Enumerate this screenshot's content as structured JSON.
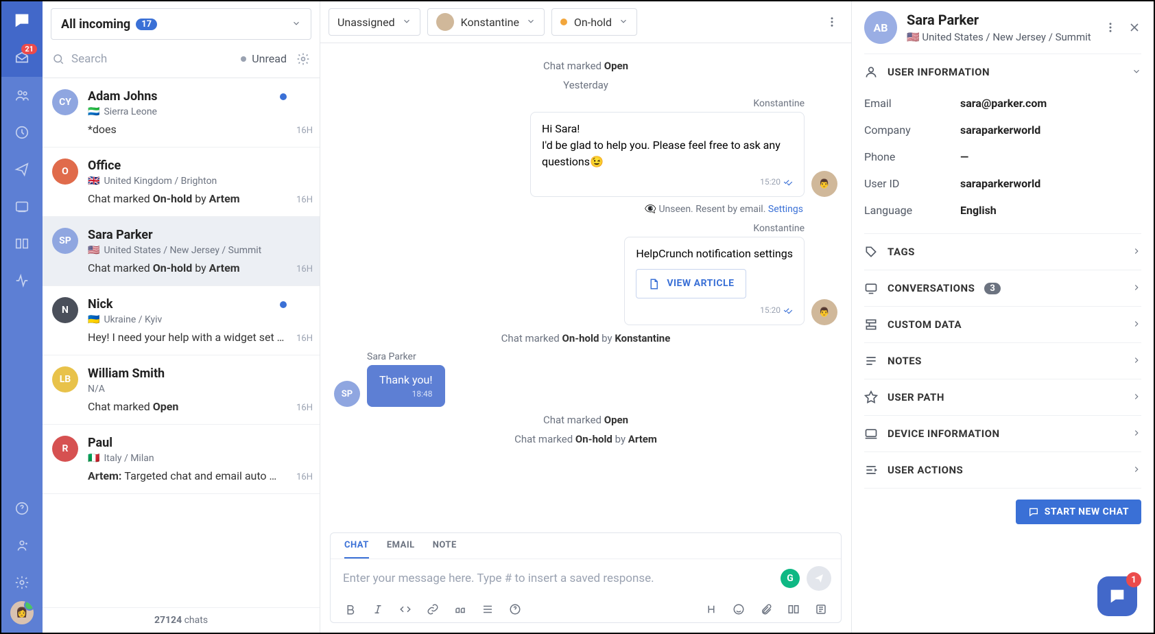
{
  "nav": {
    "inbox_badge": "21"
  },
  "list": {
    "filter_label": "All incoming",
    "filter_count": "17",
    "search_placeholder": "Search",
    "unread_label": "Unread",
    "footer_count": "27124",
    "footer_label": " chats"
  },
  "conversations": [
    {
      "initials": "CY",
      "color": "#8fa6e0",
      "name": "Adam Johns",
      "flag": "🇸🇱",
      "location": "Sierra Leone",
      "preview": "*does",
      "time": "16H",
      "unread": true
    },
    {
      "initials": "O",
      "color": "#e06b4b",
      "name": "Office",
      "flag": "🇬🇧",
      "location": "United Kingdom / Brighton",
      "preview_prefix": "Chat marked ",
      "preview_bold": "On-hold",
      "preview_suffix": " by ",
      "preview_bold2": "Artem",
      "time": "16H"
    },
    {
      "initials": "SP",
      "color": "#8fa6e0",
      "name": "Sara Parker",
      "flag": "🇺🇸",
      "location": "United States / New Jersey / Summit",
      "preview_prefix": "Chat marked ",
      "preview_bold": "On-hold",
      "preview_suffix": " by ",
      "preview_bold2": "Artem",
      "time": "16H",
      "selected": true
    },
    {
      "initials": "N",
      "color": "#4a4f5a",
      "name": "Nick",
      "flag": "🇺🇦",
      "location": "Ukraine / Kyiv",
      "preview": "Hey! I need your help with a widget set …",
      "time": "16H",
      "unread": true
    },
    {
      "initials": "LB",
      "color": "#e8c24a",
      "name": "William Smith",
      "location": "N/A",
      "preview_prefix": "Chat marked ",
      "preview_bold": "Open",
      "time": "16H"
    },
    {
      "initials": "R",
      "color": "#d65151",
      "name": "Paul",
      "flag": "🇮🇹",
      "location": "Italy / Milan",
      "preview_boldlead": "Artem: ",
      "preview": "Targeted chat and email auto …",
      "time": "16H"
    }
  ],
  "chat": {
    "dd_unassigned": "Unassigned",
    "dd_agent": "Konstantine",
    "dd_status": "On-hold",
    "marked_open_prefix": "Chat marked ",
    "marked_open": "Open",
    "yesterday": "Yesterday",
    "agent_name": "Konstantine",
    "msg1_line1": "Hi Sara!",
    "msg1_line2": "I'd be glad to help you. Please feel free to ask any questions😉",
    "msg1_time": "15:20",
    "unseen_prefix": "Unseen. Resent by email. ",
    "unseen_link": "Settings",
    "msg2_text": "HelpCrunch notification settings",
    "view_article": "VIEW ARTICLE",
    "msg2_time": "15:20",
    "marked_onhold_prefix": "Chat marked ",
    "marked_onhold": "On-hold",
    "marked_onhold_by": " by ",
    "marked_onhold_agent": "Konstantine",
    "user_name": "Sara Parker",
    "msg3_text": "Thank you!",
    "msg3_time": "18:48",
    "marked_open2_prefix": "Chat marked ",
    "marked_open2": "Open",
    "marked_onhold2_prefix": "Chat marked ",
    "marked_onhold2": "On-hold",
    "marked_onhold2_by": " by ",
    "marked_onhold2_agent": "Artem",
    "tab_chat": "CHAT",
    "tab_email": "EMAIL",
    "tab_note": "NOTE",
    "composer_placeholder": "Enter your message here. Type # to insert a saved response."
  },
  "details": {
    "initials": "AB",
    "name": "Sara Parker",
    "flag": "🇺🇸",
    "location": "United States / New Jersey / Summit",
    "user_info_title": "USER INFORMATION",
    "fields": [
      {
        "label": "Email",
        "value": "sara@parker.com"
      },
      {
        "label": "Company",
        "value": "saraparkerworld"
      },
      {
        "label": "Phone",
        "value": "—"
      },
      {
        "label": "User ID",
        "value": "saraparkerworld"
      },
      {
        "label": "Language",
        "value": "English"
      }
    ],
    "sections": [
      {
        "icon": "tag",
        "title": "TAGS"
      },
      {
        "icon": "conv",
        "title": "CONVERSATIONS",
        "count": "3"
      },
      {
        "icon": "custom",
        "title": "CUSTOM DATA"
      },
      {
        "icon": "notes",
        "title": "NOTES"
      },
      {
        "icon": "path",
        "title": "USER PATH"
      },
      {
        "icon": "device",
        "title": "DEVICE INFORMATION"
      },
      {
        "icon": "actions",
        "title": "USER ACTIONS"
      }
    ],
    "start_chat": "START NEW CHAT"
  },
  "float_badge": "1"
}
